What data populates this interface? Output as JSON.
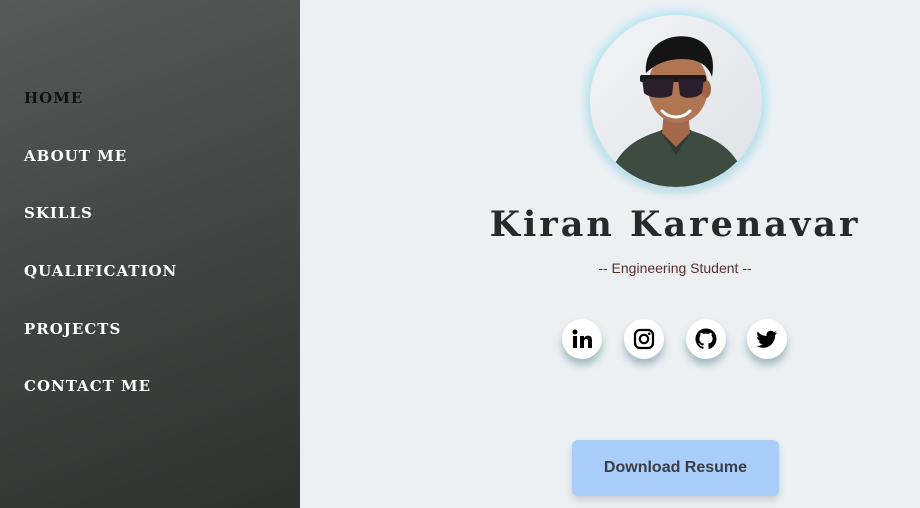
{
  "sidebar": {
    "items": [
      {
        "label": "HOME",
        "active": true
      },
      {
        "label": "ABOUT ME"
      },
      {
        "label": "SKILLS"
      },
      {
        "label": "QUALIFICATION"
      },
      {
        "label": "PROJECTS"
      },
      {
        "label": "CONTACT ME"
      }
    ]
  },
  "profile": {
    "name": "Kiran Karenavar",
    "subtitle": "-- Engineering Student --",
    "avatar_icon": "profile-photo"
  },
  "social": [
    {
      "icon": "linkedin-icon"
    },
    {
      "icon": "instagram-icon"
    },
    {
      "icon": "github-icon"
    },
    {
      "icon": "twitter-icon"
    }
  ],
  "actions": {
    "download_label": "Download Resume"
  },
  "colors": {
    "sidebar_top": "#585a59",
    "sidebar_bottom": "#2f312f",
    "background": "#ecf0f3",
    "button": "#a8cef9",
    "avatar_glow": "#aee6f6"
  }
}
